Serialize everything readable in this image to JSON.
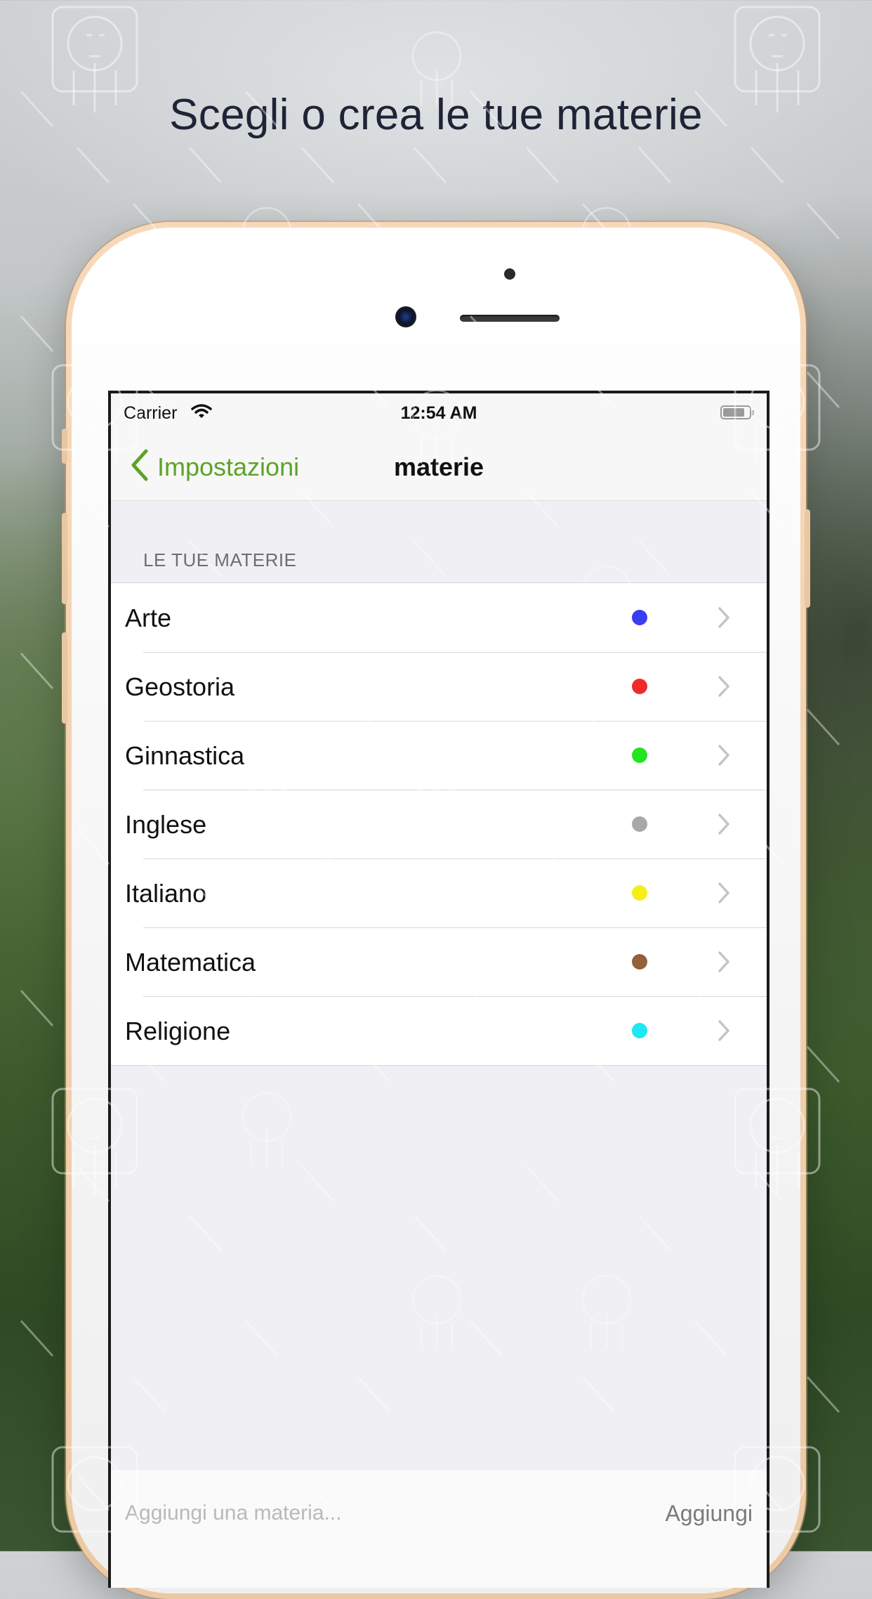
{
  "headline": "Scegli o crea le tue materie",
  "status_bar": {
    "carrier": "Carrier",
    "time": "12:54 AM"
  },
  "nav": {
    "back_label": "Impostazioni",
    "title": "materie",
    "accent_color": "#5da329"
  },
  "section": {
    "header": "LE TUE MATERIE"
  },
  "subjects": [
    {
      "label": "Arte",
      "color": "#3a3df0"
    },
    {
      "label": "Geostoria",
      "color": "#f02a2a"
    },
    {
      "label": "Ginnastica",
      "color": "#22e41f"
    },
    {
      "label": "Inglese",
      "color": "#a8a8a8"
    },
    {
      "label": "Italiano",
      "color": "#f4ef1a"
    },
    {
      "label": "Matematica",
      "color": "#93603a"
    },
    {
      "label": "Religione",
      "color": "#1ee8f2"
    }
  ],
  "add_bar": {
    "placeholder": "Aggiungi una materia...",
    "button_label": "Aggiungi"
  }
}
